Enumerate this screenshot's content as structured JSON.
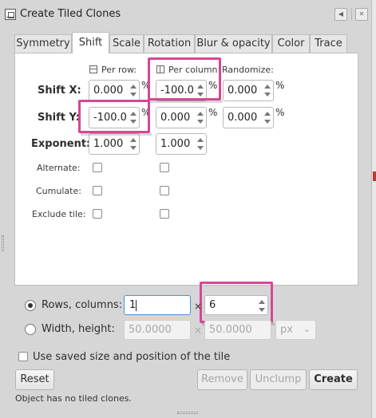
{
  "window": {
    "title": "Create Tiled Clones"
  },
  "tabs": [
    "Symmetry",
    "Shift",
    "Scale",
    "Rotation",
    "Blur & opacity",
    "Color",
    "Trace"
  ],
  "columns": {
    "per_row": "Per row:",
    "per_column": "Per column:",
    "randomize": "Randomize:"
  },
  "shift_x": {
    "label": "Shift X:",
    "per_row": "0.000",
    "per_column": "-100.0",
    "randomize": "0.000",
    "unit": "%"
  },
  "shift_y": {
    "label": "Shift Y:",
    "per_row": "-100.0",
    "per_column": "0.000",
    "randomize": "0.000",
    "unit": "%"
  },
  "exponent": {
    "label": "Exponent:",
    "per_row": "1.000",
    "per_column": "1.000"
  },
  "options": {
    "alternate": "Alternate:",
    "cumulate": "Cumulate:",
    "exclude_tile": "Exclude tile:"
  },
  "rows_columns": {
    "label": "Rows, columns:",
    "rows": "1",
    "columns": "6",
    "times": "×"
  },
  "width_height": {
    "label": "Width, height:",
    "width": "50.0000",
    "height": "50.0000",
    "unit": "px",
    "times": "×"
  },
  "use_saved": "Use saved size and position of the tile",
  "buttons": {
    "reset": "Reset",
    "remove": "Remove",
    "unclump": "Unclump",
    "create": "Create"
  },
  "status": "Object has no tiled clones.",
  "colors": {
    "highlight": "#d64795",
    "focus": "#4a90d9"
  }
}
